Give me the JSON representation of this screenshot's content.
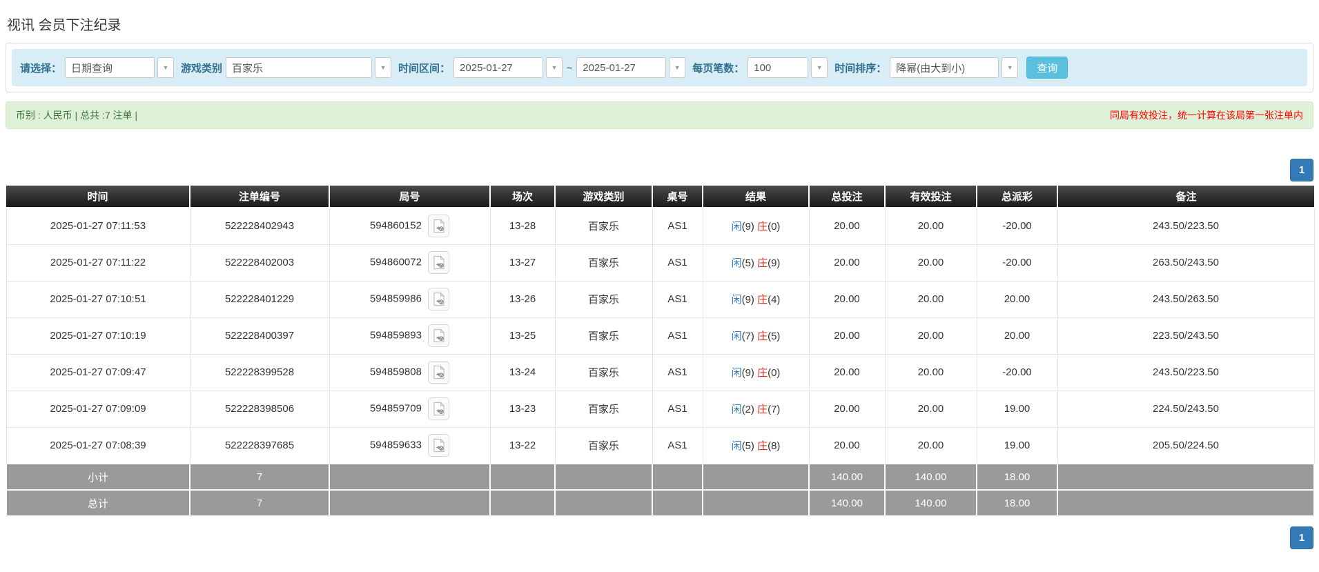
{
  "page": {
    "title": "视讯 会员下注纪录"
  },
  "colors": {
    "accent_blue": "#337ab7",
    "search_button_blue": "#5bc0de",
    "filter_bar_bg": "#d9edf7",
    "filter_label_blue": "#31708f",
    "summary_bg_green": "#dff0d8",
    "summary_text_green": "#3c763d",
    "alert_red": "#ff0000",
    "table_header_dark": "#1a1a1a",
    "table_footer_gray": "#9a9a9a"
  },
  "filters": {
    "select_label": "请选择：",
    "query_type_value": "日期查询",
    "game_category_label": "游戏类别",
    "game_category_value": "百家乐",
    "time_range_label": "时间区间：",
    "date_from_value": "2025-01-27",
    "range_separator": "~",
    "date_to_value": "2025-01-27",
    "page_size_label": "每页笔数：",
    "page_size_value": "100",
    "sort_label": "时间排序：",
    "sort_value": "降幂(由大到小)",
    "search_button_label": "查询"
  },
  "summary": {
    "left_text": "币别 : 人民币 | 总共 :7 注单 |",
    "right_note": "同局有效投注，统一计算在该局第一张注单内"
  },
  "pagination": {
    "current_page": "1"
  },
  "table": {
    "headers": [
      "时间",
      "注单编号",
      "局号",
      "场次",
      "游戏类别",
      "桌号",
      "结果",
      "总投注",
      "有效投注",
      "总派彩",
      "备注"
    ],
    "result_labels": {
      "player": "闲",
      "banker": "庄"
    },
    "rows": [
      {
        "time": "2025-01-27 07:11:53",
        "bet_id": "522228402943",
        "round_id": "594860152",
        "session": "13-28",
        "game": "百家乐",
        "table_no": "AS1",
        "player_score": "(9)",
        "banker_score": "(0)",
        "total_bet": "20.00",
        "valid_bet": "20.00",
        "payout": "-20.00",
        "remark": "243.50/223.50"
      },
      {
        "time": "2025-01-27 07:11:22",
        "bet_id": "522228402003",
        "round_id": "594860072",
        "session": "13-27",
        "game": "百家乐",
        "table_no": "AS1",
        "player_score": "(5)",
        "banker_score": "(9)",
        "total_bet": "20.00",
        "valid_bet": "20.00",
        "payout": "-20.00",
        "remark": "263.50/243.50"
      },
      {
        "time": "2025-01-27 07:10:51",
        "bet_id": "522228401229",
        "round_id": "594859986",
        "session": "13-26",
        "game": "百家乐",
        "table_no": "AS1",
        "player_score": "(9)",
        "banker_score": "(4)",
        "total_bet": "20.00",
        "valid_bet": "20.00",
        "payout": "20.00",
        "remark": "243.50/263.50"
      },
      {
        "time": "2025-01-27 07:10:19",
        "bet_id": "522228400397",
        "round_id": "594859893",
        "session": "13-25",
        "game": "百家乐",
        "table_no": "AS1",
        "player_score": "(7)",
        "banker_score": "(5)",
        "total_bet": "20.00",
        "valid_bet": "20.00",
        "payout": "20.00",
        "remark": "223.50/243.50"
      },
      {
        "time": "2025-01-27 07:09:47",
        "bet_id": "522228399528",
        "round_id": "594859808",
        "session": "13-24",
        "game": "百家乐",
        "table_no": "AS1",
        "player_score": "(9)",
        "banker_score": "(0)",
        "total_bet": "20.00",
        "valid_bet": "20.00",
        "payout": "-20.00",
        "remark": "243.50/223.50"
      },
      {
        "time": "2025-01-27 07:09:09",
        "bet_id": "522228398506",
        "round_id": "594859709",
        "session": "13-23",
        "game": "百家乐",
        "table_no": "AS1",
        "player_score": "(2)",
        "banker_score": "(7)",
        "total_bet": "20.00",
        "valid_bet": "20.00",
        "payout": "19.00",
        "remark": "224.50/243.50"
      },
      {
        "time": "2025-01-27 07:08:39",
        "bet_id": "522228397685",
        "round_id": "594859633",
        "session": "13-22",
        "game": "百家乐",
        "table_no": "AS1",
        "player_score": "(5)",
        "banker_score": "(8)",
        "total_bet": "20.00",
        "valid_bet": "20.00",
        "payout": "19.00",
        "remark": "205.50/224.50"
      }
    ],
    "footer_rows": [
      {
        "label": "小计",
        "count": "7",
        "total_bet": "140.00",
        "valid_bet": "140.00",
        "payout": "18.00"
      },
      {
        "label": "总计",
        "count": "7",
        "total_bet": "140.00",
        "valid_bet": "140.00",
        "payout": "18.00"
      }
    ]
  }
}
